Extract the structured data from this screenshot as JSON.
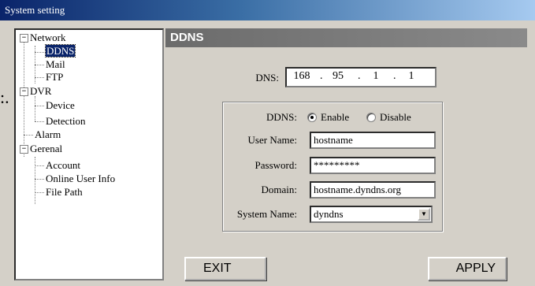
{
  "window": {
    "title": "System setting"
  },
  "tree": {
    "network": "Network",
    "ddns": "DDNS",
    "mail": "Mail",
    "ftp": "FTP",
    "dvr": "DVR",
    "device": "Device",
    "detection": "Detection",
    "alarm": "Alarm",
    "general": "Gerenal",
    "account": "Account",
    "online_user_info": "Online User Info",
    "file_path": "File Path",
    "expanded_glyph": "−"
  },
  "panel": {
    "header": "DDNS",
    "dns_label": "DNS:",
    "dns_ip": [
      "168",
      "95",
      "1",
      "1"
    ],
    "ip_separator": ".",
    "ddns_label": "DDNS:",
    "ddns_options": {
      "enable": "Enable",
      "disable": "Disable",
      "selected": "enable"
    },
    "username_label": "User Name:",
    "username_value": "hostname",
    "password_label": "Password:",
    "password_value": "*********",
    "domain_label": "Domain:",
    "domain_value": "hostname.dyndns.org",
    "system_name_label": "System Name:",
    "system_name_value": "dyndns",
    "dropdown_glyph": "▼"
  },
  "buttons": {
    "exit": "EXIT",
    "apply": "APPLY"
  },
  "stray_mark": ":."
}
